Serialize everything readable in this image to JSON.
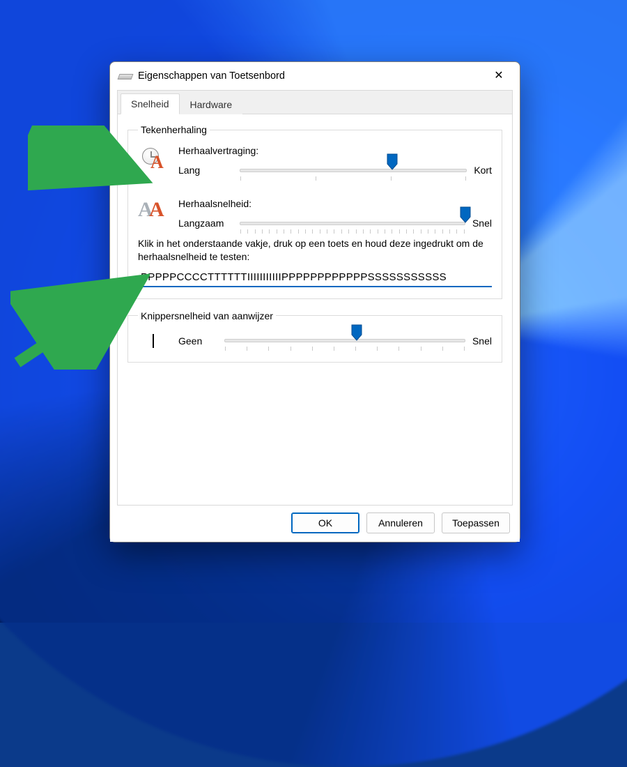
{
  "window": {
    "title": "Eigenschappen van Toetsenbord"
  },
  "tabs": {
    "speed": "Snelheid",
    "hardware": "Hardware"
  },
  "groups": {
    "repeat": {
      "legend": "Tekenherhaling",
      "delay": {
        "label": "Herhaalvertraging:",
        "min": "Lang",
        "max": "Kort",
        "value_percent": 67
      },
      "rate": {
        "label": "Herhaalsnelheid:",
        "min": "Langzaam",
        "max": "Snel",
        "value_percent": 100
      },
      "test_help": "Klik in het onderstaande vakje, druk op een toets en houd deze ingedrukt om de herhaalsnelheid te testen:",
      "test_value": "PPPPPCCCCTTTTTTIIIIIIIIIIIPPPPPPPPPPPPSSSSSSSSSSS"
    },
    "blink": {
      "legend": "Knippersnelheid van aanwijzer",
      "min": "Geen",
      "max": "Snel",
      "value_percent": 55
    }
  },
  "buttons": {
    "ok": "OK",
    "cancel": "Annuleren",
    "apply": "Toepassen"
  }
}
